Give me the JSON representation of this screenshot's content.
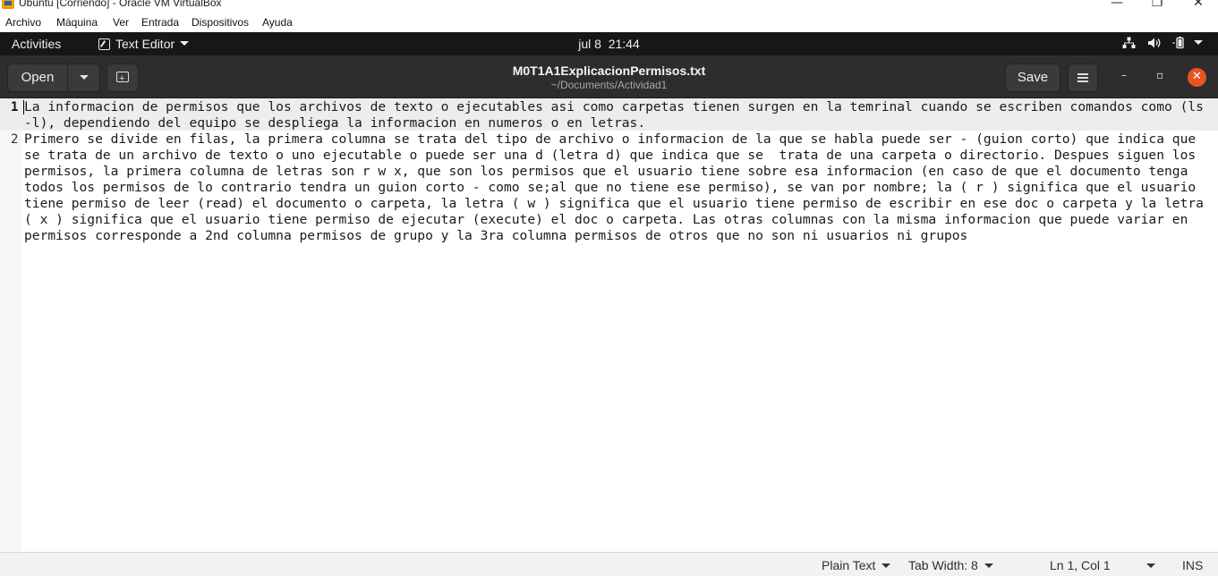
{
  "host_window": {
    "title": "Ubuntu [Corriendo] - Oracle VM VirtualBox",
    "controls": {
      "minimize": "—",
      "maximize": "❐",
      "close": "✕"
    }
  },
  "host_menu": {
    "items": [
      "Archivo",
      "Máquina",
      "Ver",
      "Entrada",
      "Dispositivos",
      "Ayuda"
    ]
  },
  "top_bar": {
    "activities": "Activities",
    "app_menu": "Text Editor",
    "clock": "jul 8  21:44",
    "tray_icons": [
      "network-icon",
      "volume-icon",
      "battery-icon",
      "system-menu-caret"
    ]
  },
  "header_bar": {
    "open_label": "Open",
    "doc_title": "M0T1A1ExplicacionPermisos.txt",
    "doc_subtitle": "~/Documents/Actividad1",
    "save_label": "Save",
    "window_controls": {
      "minimize": "–",
      "maximize": "▫",
      "close": "✕"
    }
  },
  "document": {
    "lines": [
      {
        "number": "1",
        "text": "La informacion de permisos que los archivos de texto o ejecutables asi como carpetas tienen surgen en la temrinal cuando se escriben comandos como (ls -l), dependiendo del equipo se despliega la informacion en numeros o en letras."
      },
      {
        "number": "2",
        "text": "Primero se divide en filas, la primera columna se trata del tipo de archivo o informacion de la que se habla puede ser - (guion corto) que indica que se trata de un archivo de texto o uno ejecutable o puede ser una d (letra d) que indica que se  trata de una carpeta o directorio. Despues siguen los permisos, la primera columna de letras son r w x, que son los permisos que el usuario tiene sobre esa informacion (en caso de que el documento tenga todos los permisos de lo contrario tendra un guion corto - como se;al que no tiene ese permiso), se van por nombre; la ( r ) significa que el usuario tiene permiso de leer (read) el documento o carpeta, la letra ( w ) significa que el usuario tiene permiso de escribir en ese doc o carpeta y la letra ( x ) significa que el usuario tiene permiso de ejecutar (execute) el doc o carpeta. Las otras columnas con la misma informacion que puede variar en permisos corresponde a 2nd columna permisos de grupo y la 3ra columna permisos de otros que no son ni usuarios ni grupos"
      }
    ]
  },
  "status_bar": {
    "language": "Plain Text",
    "tab_width": "Tab Width: 8",
    "position": "Ln 1, Col 1",
    "mode": "INS"
  }
}
